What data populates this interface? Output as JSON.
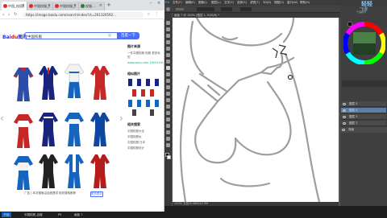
{
  "browser": {
    "tabs": [
      {
        "label": "中国_校园服…"
      },
      {
        "label": "中国校服_百…"
      },
      {
        "label": "中国校服_百…"
      },
      {
        "label": "校服…"
      }
    ],
    "url": "https://image.baidu.com/search/index?ct=201326592…",
    "logo_a": "Bai",
    "logo_b": "du",
    "logo_c": "图片",
    "search_value": "中国校服",
    "search_button": "百度一下",
    "sidebar": {
      "heading1": "图片来源",
      "text1": "一件中国校服 校服 更多标的",
      "text2": "www.sohu.com 1920x1080",
      "heading2": "相似图片",
      "heading3": "相关搜索",
      "related": [
        "中国校服大全",
        "中国校服女",
        "中国校服 日本",
        "中国校服设计"
      ]
    },
    "ad_text": "广告 | 本次搜索由百度提供 相关搜索推荐",
    "ad_button": "更多图片"
  },
  "taskbar": {
    "items": [
      "开始",
      "中国校服_百度",
      "PS",
      "画板 7"
    ]
  },
  "photoshop": {
    "menu": [
      "PS",
      "文件(F)",
      "编辑(E)",
      "图像(I)",
      "图层(L)",
      "文字(Y)",
      "选择(S)",
      "滤镜(T)",
      "3D(D)",
      "视图(V)",
      "窗口(W)",
      "帮助(H)"
    ],
    "doc_tab": "画板 7 @ 100% (图层 1, RGB/8) *",
    "status": "100%    文档:8.46M/42.9M",
    "brand_a": "轻轻",
    "brand_b": "飞漫",
    "brand_c": "千语教育",
    "layers": [
      "图层 5",
      "图层 4",
      "图层 3",
      "图层 2",
      "背景"
    ]
  }
}
